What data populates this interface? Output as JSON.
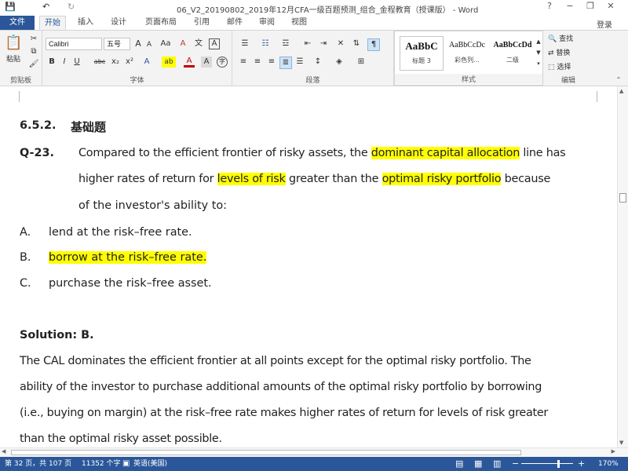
{
  "window": {
    "title": "06_V2_20190802_2019年12月CFA一级百题预测_组合_金程教育（授课版） - Word",
    "help": "?",
    "minimize": "−",
    "restore": "❐",
    "close": "✕"
  },
  "qat": {
    "save": "💾",
    "undo": "↶",
    "redo": "↻"
  },
  "tabs": {
    "file": "文件",
    "items": [
      "开始",
      "插入",
      "设计",
      "页面布局",
      "引用",
      "邮件",
      "审阅",
      "视图"
    ],
    "active": "开始",
    "login": "登录"
  },
  "ribbon": {
    "clipboard": {
      "label": "剪贴板",
      "paste": "粘贴"
    },
    "font": {
      "label": "字体",
      "name": "Calibri",
      "size": "五号",
      "bold": "B",
      "italic": "I",
      "underline": "U",
      "strike": "abc",
      "sub": "x₂",
      "sup": "x²",
      "grow": "A",
      "shrink": "A",
      "case": "Aa",
      "clear": "A",
      "phonetic": "文",
      "border": "A",
      "highlight": "ab",
      "color": "A",
      "shade": "A",
      "enclose": "字"
    },
    "paragraph": {
      "label": "段落"
    },
    "styles": {
      "label": "样式",
      "items": [
        {
          "preview": "AaBbC",
          "name": "标题 3"
        },
        {
          "preview": "AaBbCcDc",
          "name": "彩色列..."
        },
        {
          "preview": "AaBbCcDd",
          "name": "二级"
        }
      ]
    },
    "editing": {
      "label": "编辑",
      "find": "查找",
      "replace": "替换",
      "select": "选择"
    }
  },
  "document": {
    "heading": {
      "num": "6.5.2.",
      "text": "基础题"
    },
    "question": {
      "id": "Q-23.",
      "l1a": "Compared to the efficient frontier of risky assets, the ",
      "l1hl": "dominant capital allocation",
      "l1b": " line has",
      "l2a": "higher rates of return for ",
      "l2hl1": "levels of risk",
      "l2b": " greater than the ",
      "l2hl2": "optimal risky portfolio",
      "l2c": " because",
      "l3": "of the investor's ability to:"
    },
    "options": [
      {
        "letter": "A.",
        "text": "lend at the risk–free rate.",
        "highlight": false
      },
      {
        "letter": "B.",
        "text": "borrow at the risk–free rate.",
        "highlight": true
      },
      {
        "letter": "C.",
        "text": "purchase the risk–free asset.",
        "highlight": false
      }
    ],
    "solution": {
      "title": "Solution: B.",
      "lines": [
        "The CAL dominates the efficient frontier at all points except for the optimal risky portfolio. The",
        "ability of the investor to purchase additional amounts of the optimal risky portfolio by borrowing",
        "(i.e., buying on margin) at the risk–free rate makes higher rates of return for levels of risk greater",
        "than the optimal risky asset possible."
      ]
    }
  },
  "status": {
    "page": "第 32 页，共 107 页",
    "words": "11352 个字",
    "lang": "英语(美国)",
    "zoom": "170%",
    "zoom_minus": "−",
    "zoom_plus": "+"
  },
  "colors": {
    "accent": "#2b579a",
    "highlight": "#ffff00"
  }
}
